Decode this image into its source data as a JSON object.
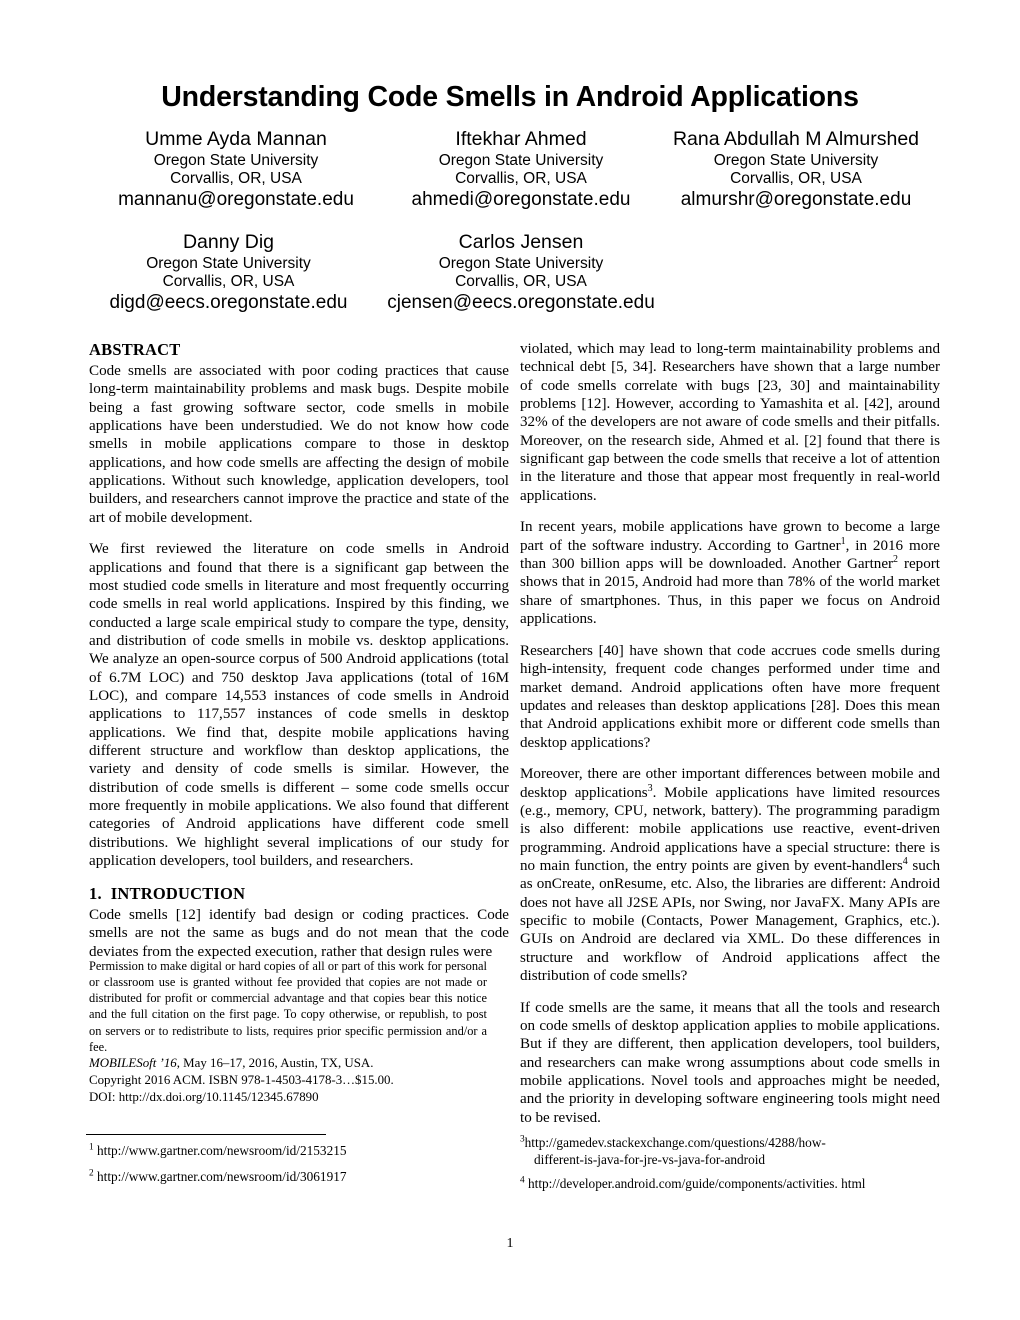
{
  "paper": {
    "title": "Understanding Code Smells in Android Applications",
    "authors_row1": [
      {
        "name": "Umme Ayda Mannan",
        "affiliation": "Oregon State University",
        "location": "Corvallis, OR, USA",
        "email": "mannanu@oregonstate.edu"
      },
      {
        "name": "Iftekhar Ahmed",
        "affiliation": "Oregon State University",
        "location": "Corvallis, OR, USA",
        "email": "ahmedi@oregonstate.edu"
      },
      {
        "name": "Rana Abdullah M Almurshed",
        "affiliation": "Oregon State University",
        "location": "Corvallis, OR, USA",
        "email": "almurshr@oregonstate.edu"
      }
    ],
    "authors_row2": [
      {
        "name": "Danny Dig",
        "affiliation": "Oregon State University",
        "location": "Corvallis, OR, USA",
        "email": "digd@eecs.oregonstate.edu"
      },
      {
        "name": "Carlos Jensen",
        "affiliation": "Oregon State University",
        "location": "Corvallis, OR, USA",
        "email": "cjensen@eecs.oregonstate.edu"
      }
    ],
    "abstract": {
      "heading": "ABSTRACT",
      "paragraphs": [
        "Code smells are associated with poor coding practices that cause long-term maintainability problems and mask bugs. Despite mobile being a fast growing software sector, code smells in mobile applications have been understudied. We do not know how code smells in mobile applications compare to those in desktop applications, and how code smells are affecting the design of mobile applications. Without such knowledge, application developers, tool builders, and researchers cannot improve the practice and state of the art of mobile development.",
        "We first reviewed the literature on code smells in Android applications and found that there is a significant gap between the most studied code smells in literature and most frequently occurring code smells in real world applications. Inspired by this finding, we conducted a large scale empirical study to compare the type, density, and distribution of code smells in mobile vs. desktop applications. We analyze an open-source corpus of 500 Android applications (total of 6.7M LOC) and 750 desktop Java applications (total of 16M LOC), and compare 14,553 instances of code smells in Android applications to 117,557 instances of code smells in desktop applications. We find that, despite mobile applications having different structure and workflow than desktop applications, the variety and density of code smells is similar. However, the distribution of code smells is different – some code smells occur more frequently in mobile applications. We also found that different categories of Android applications have different code smell distributions. We highlight several implications of our study for application developers, tool builders, and researchers."
      ]
    },
    "introduction": {
      "number": "1.",
      "heading": "INTRODUCTION",
      "paragraph_left": "Code smells [12] identify bad design or coding practices. Code smells are not the same as bugs and do not mean that the code deviates from the expected execution, rather that design rules were"
    },
    "right_column": {
      "paragraphs": [
        {
          "id": "para-violated",
          "segments": [
            {
              "t": "violated, which may lead to long-term maintainability problems and technical debt [5, 34]. Researchers have shown that a large number of code smells correlate with bugs [23, 30] and maintainability problems [12]. However, according to Yamashita et al. [42], around 32% of the developers are not aware of code smells and their pitfalls. Moreover, on the research side, Ahmed et al. [2] found that there is significant gap between the code smells that receive a lot of attention in the literature and those that appear most frequently in real-world applications."
            }
          ]
        },
        {
          "id": "para-recent-years",
          "segments": [
            {
              "t": "In recent years, mobile applications have grown to become a large part of the software industry. According to Gartner"
            },
            {
              "sup": "1"
            },
            {
              "t": ", in 2016 more than 300 billion apps will be downloaded. Another Gartner"
            },
            {
              "sup": "2"
            },
            {
              "t": " report shows that in 2015, Android had more than 78% of the world market share of smartphones. Thus, in this paper we focus on Android applications."
            }
          ]
        },
        {
          "id": "para-researchers",
          "segments": [
            {
              "t": "Researchers [40] have shown that code accrues code smells during high-intensity, frequent code changes performed under time and market demand. Android applications often have more frequent updates and releases than desktop applications [28]. Does this mean that Android applications exhibit more or different code smells than desktop applications?"
            }
          ]
        },
        {
          "id": "para-moreover",
          "segments": [
            {
              "t": "Moreover, there are other important differences between mobile and desktop applications"
            },
            {
              "sup": "3"
            },
            {
              "t": ". Mobile applications have limited resources (e.g., memory, CPU, network, battery). The programming paradigm is also different: mobile applications use reactive, event-driven programming. Android applications have a special structure: there is no main function, the entry points are given by event-handlers"
            },
            {
              "sup": "4"
            },
            {
              "t": " such as onCreate, onResume, etc. Also, the libraries are different: Android does not have all J2SE APIs, nor Swing, nor JavaFX. Many APIs are specific to mobile (Contacts, Power Management, Graphics, etc.). GUIs on Android are declared via XML. Do these differences in structure and workflow of Android applications affect the distribution of code smells?"
            }
          ]
        },
        {
          "id": "para-if-code-smells",
          "segments": [
            {
              "t": "If code smells are the same, it means that all the tools and research on code smells of desktop application applies to mobile applications. But if they are different, then application developers, tool builders, and researchers can make wrong assumptions about code smells in mobile applications. Novel tools and approaches might be needed, and the priority in developing software engineering tools might need to be revised."
            }
          ]
        }
      ]
    },
    "copyright": {
      "permission": "Permission to make digital or hard copies of all or part of this work for personal or classroom use is granted without fee provided that copies are not made or distributed for profit or commercial advantage and that copies bear this notice and the full citation on the first page. To copy otherwise, or republish, to post on servers or to redistribute to lists, requires prior specific permission and/or a fee.",
      "conference_italic": "MOBILESoft ’16",
      "conference_rest": ", May 16–17, 2016, Austin, TX, USA.",
      "acm_copyright": "Copyright 2016 ACM. ISBN 978-1-4503-4178-3…$15.00.",
      "doi": "DOI: http://dx.doi.org/10.1145/12345.67890"
    },
    "footnotes": {
      "left": [
        {
          "num": "1",
          "text": "http://www.gartner.com/newsroom/id/2153215"
        },
        {
          "num": "2",
          "text": "http://www.gartner.com/newsroom/id/3061917"
        }
      ],
      "right": [
        {
          "num": "3",
          "text": "http://gamedev.stackexchange.com/questions/4288/how-",
          "cont": "different-is-java-for-jre-vs-java-for-android"
        },
        {
          "num": "4",
          "text": " http://developer.android.com/guide/components/activities. html",
          "cont": ""
        }
      ]
    },
    "page_number": "1"
  }
}
